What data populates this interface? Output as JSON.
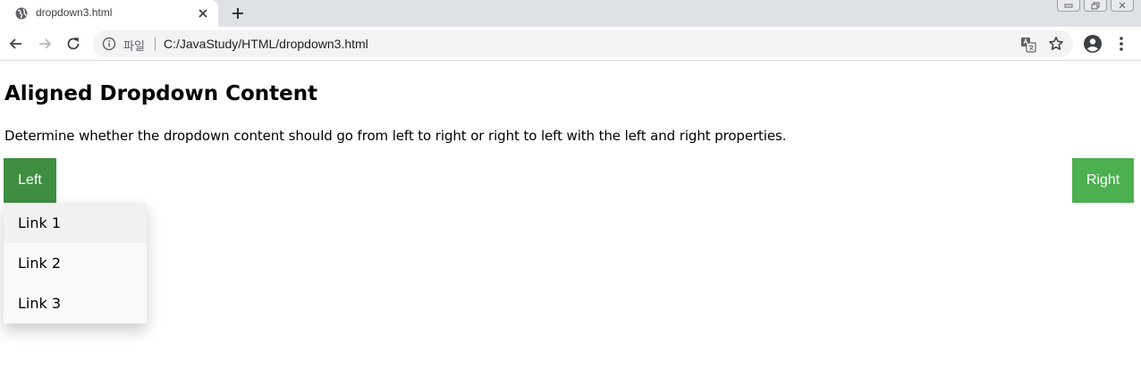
{
  "browser": {
    "tab_title": "dropdown3.html",
    "scheme_label": "파일",
    "url": "C:/JavaStudy/HTML/dropdown3.html"
  },
  "page": {
    "title": "Aligned Dropdown Content",
    "description": "Determine whether the dropdown content should go from left to right or right to left with the left and right properties.",
    "left_button": "Left",
    "right_button": "Right",
    "menu_items": [
      "Link 1",
      "Link 2",
      "Link 3"
    ]
  },
  "colors": {
    "button_hover": "#3e8e41",
    "button": "#4caf50",
    "menu_bg": "#f9f9f9",
    "menu_hover": "#f1f1f1"
  }
}
